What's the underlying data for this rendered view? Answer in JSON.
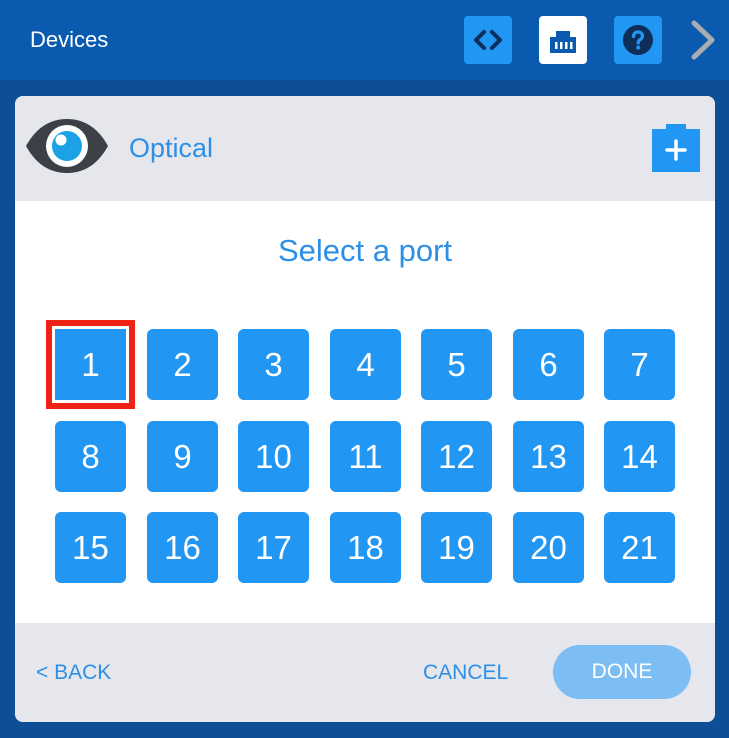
{
  "header": {
    "title": "Devices",
    "buttons": [
      {
        "name": "code-view",
        "icon": "code-brackets-icon",
        "active": false
      },
      {
        "name": "port-view",
        "icon": "ethernet-port-icon",
        "active": true
      },
      {
        "name": "help",
        "icon": "question-icon",
        "active": false
      }
    ],
    "next_icon": "chevron-right-icon"
  },
  "device": {
    "icon": "eye-icon",
    "name": "Optical",
    "add_icon": "add-battery-icon"
  },
  "prompt": "Select a port",
  "ports": [
    "1",
    "2",
    "3",
    "4",
    "5",
    "6",
    "7",
    "8",
    "9",
    "10",
    "11",
    "12",
    "13",
    "14",
    "15",
    "16",
    "17",
    "18",
    "19",
    "20",
    "21"
  ],
  "selected_port": "1",
  "footer": {
    "back_label": "< BACK",
    "cancel_label": "CANCEL",
    "done_label": "DONE",
    "done_enabled": false
  },
  "colors": {
    "topbar": "#0a5bb0",
    "background": "#0d4f97",
    "accent": "#2196f3",
    "text_accent": "#2e8fe6",
    "selection": "#ee2314",
    "done_disabled": "#7cbdf3",
    "panel_header": "#e6e7ec"
  }
}
